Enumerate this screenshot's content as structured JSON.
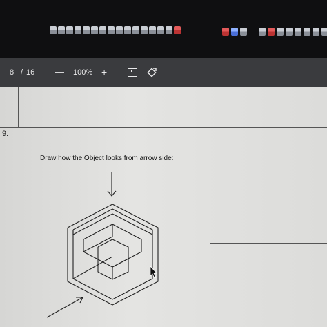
{
  "toolbar": {
    "page_current": "8",
    "page_separator": "/",
    "page_total": "16",
    "zoom_out_label": "—",
    "zoom_level": "100%",
    "zoom_in_label": "+"
  },
  "document": {
    "question_number": "9.",
    "instruction": "Draw how the Object looks from arrow side:"
  },
  "icons": {
    "fit": "fit-page-icon",
    "rotate": "rotate-icon",
    "cursor": "mouse-pointer-icon"
  }
}
